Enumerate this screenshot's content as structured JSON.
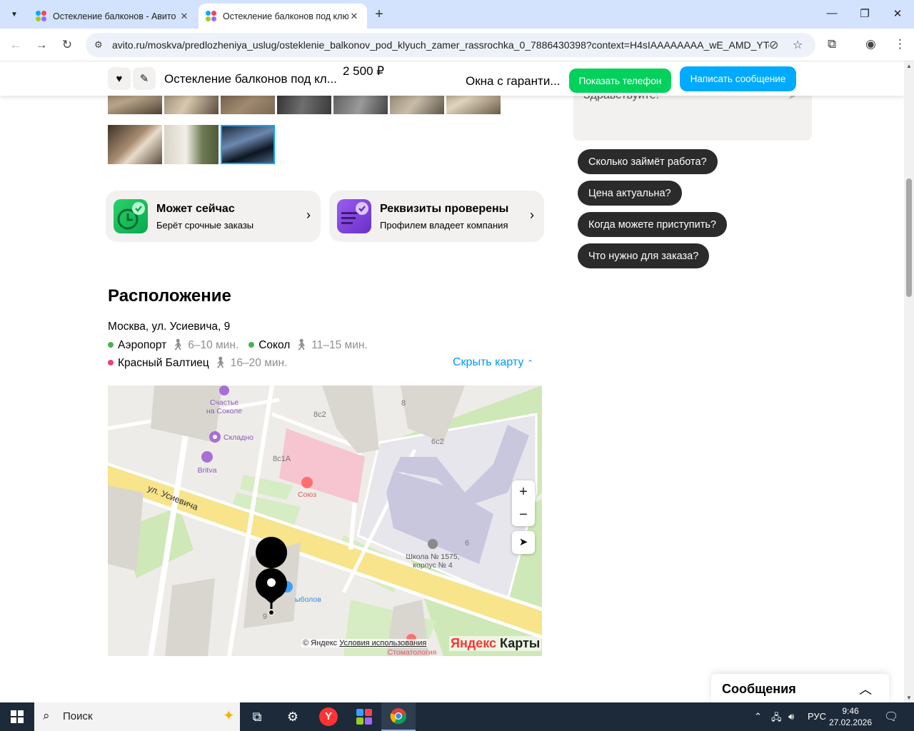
{
  "browser": {
    "tabs": [
      {
        "title": "Остекление балконов - Авито",
        "active": false
      },
      {
        "title": "Остекление балконов под клю",
        "active": true
      }
    ],
    "url": "avito.ru/moskva/predlozheniya_uslug/osteklenie_balkonov_pod_klyuch_zamer_rassrochka_0_7886430398?context=H4sIAAAAAAAA_wE_AMD_YTo..."
  },
  "sticky_header": {
    "title": "Остеклeние балконов под кл...",
    "price": "2 500 ₽",
    "seller": "Окна с гаранти...",
    "phone_button": "Показать телефон",
    "message_button": "Написать сообщение"
  },
  "badges": [
    {
      "title": "Может сейчас",
      "subtitle": "Берёт срочные заказы"
    },
    {
      "title": "Реквизиты проверены",
      "subtitle": "Профилем владеет компания"
    }
  ],
  "location": {
    "title": "Расположение",
    "address": "Москва, ул. Усиевича, 9",
    "metro": [
      {
        "name": "Аэропорт",
        "time": "6–10 мин.",
        "color": "#4cb050"
      },
      {
        "name": "Сокол",
        "time": "11–15 мин.",
        "color": "#4cb050"
      },
      {
        "name": "Красный Балтиец",
        "time": "16–20 мин.",
        "color": "#e8437a"
      }
    ],
    "hide_map": "Скрыть карту"
  },
  "map": {
    "labels": {
      "schastye": "Счастье\nна Соколе",
      "skladno": "Складно",
      "britva": "Britva",
      "b8c2": "8с2",
      "b8": "8",
      "b6c2": "6с2",
      "b8c1a": "8с1А",
      "soyuz": "Союз",
      "street": "ул. Усиевича",
      "b6": "6",
      "school": "Школа № 1575,\nкорпус № 4",
      "rybolov": "ыболов",
      "b9": "9",
      "stomat": "Стоматология"
    },
    "copyright": "© Яндекс",
    "terms": "Условия использования",
    "logo_y": "Яндекс",
    "logo_rest": " Карты"
  },
  "chat": {
    "partial_text": "Здравствуйте!",
    "quick_replies": [
      "Сколько займёт работа?",
      "Цена актуальна?",
      "Когда можете приступить?",
      "Что нужно для заказа?"
    ]
  },
  "messages_panel": {
    "title": "Сообщения"
  },
  "taskbar": {
    "search": "Поиск",
    "lang": "РУС",
    "time": "9:46",
    "date": "27.02.2026"
  }
}
